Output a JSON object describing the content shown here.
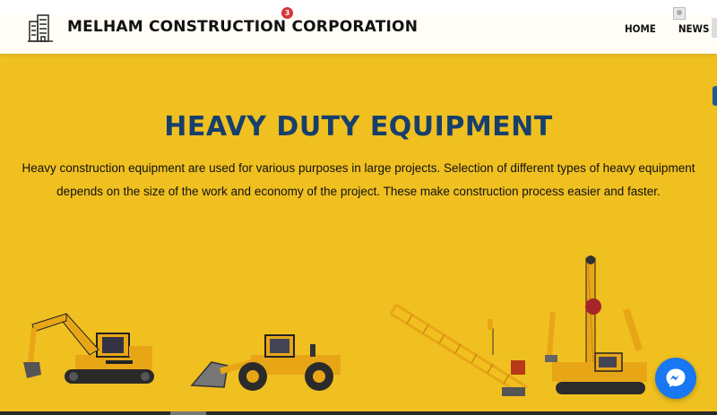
{
  "admin_bar": {
    "notifications": "3"
  },
  "header": {
    "brand": "MELHAM CONSTRUCTION CORPORATION",
    "nav": [
      "HOME",
      "NEWS | U"
    ]
  },
  "hero": {
    "title": "HEAVY DUTY EQUIPMENT",
    "description": "Heavy construction equipment are used for various purposes in large projects. Selection of different types of heavy equipment depends on the size of the work and economy of the project. These make construction process easier and faster."
  },
  "colors": {
    "background": "#f0c020",
    "title": "#173f6b",
    "messenger": "#1877f2"
  },
  "equipment": [
    "excavator",
    "wheel-loader",
    "tower-crane",
    "rotary-drilling-rig"
  ]
}
